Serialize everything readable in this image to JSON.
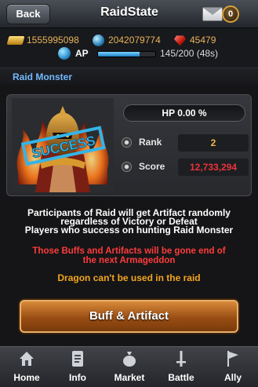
{
  "header": {
    "back_label": "Back",
    "title": "RaidState",
    "mail_count": "0"
  },
  "resources": {
    "gold": "1555995098",
    "gems": "2042079774",
    "rubies": "45479",
    "ap_label": "AP",
    "ap_value": "145/200 (48s)",
    "ap_fill_fraction": 0.725
  },
  "section": {
    "label": "Raid Monster"
  },
  "monster": {
    "hp_text": "HP 0.00 %",
    "stamp": "SUCCESS",
    "rank_label": "Rank",
    "rank_value": "2",
    "score_label": "Score",
    "score_value": "12,733,294"
  },
  "info": {
    "line1": "Participants of Raid will get Artifact randomly",
    "line2": "regardless of Victory or Defeat",
    "line3": "Players who success on hunting Raid Monster",
    "warning1": "Those Buffs and Artifacts will be gone end of",
    "warning2": "the next Armageddon",
    "dragon": "Dragon can't be used in the raid"
  },
  "buff_button": {
    "label": "Buff & Artifact"
  },
  "nav": {
    "home": "Home",
    "info": "Info",
    "market": "Market",
    "battle": "Battle",
    "ally": "Ally"
  },
  "colors": {
    "accent_blue": "#74b9ff",
    "gold_text": "#e8b35a",
    "score_red": "#e8343a",
    "warning_red": "#ff3b3b",
    "dragon_orange": "#f2a51d"
  }
}
